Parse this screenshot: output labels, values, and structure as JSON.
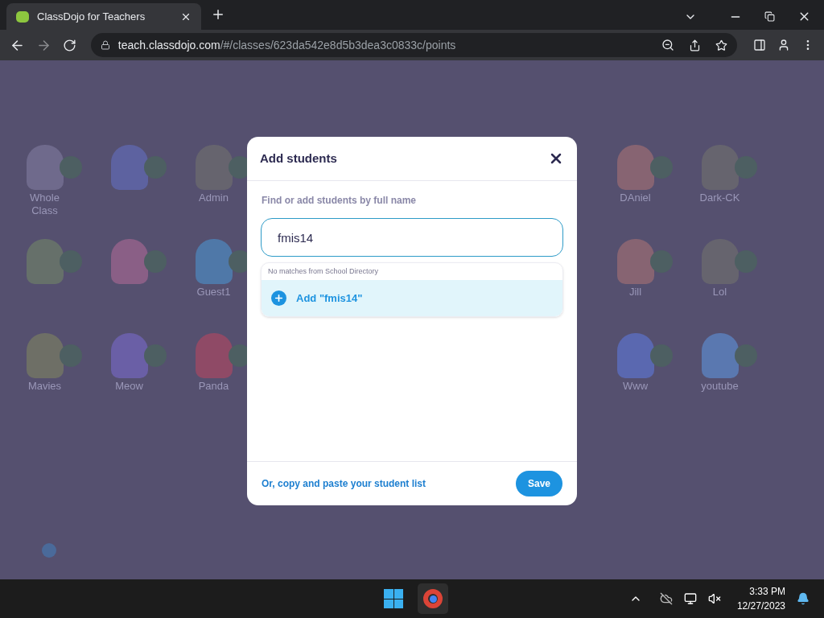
{
  "browser": {
    "tab_title": "ClassDojo for Teachers",
    "url_host": "teach.classdojo.com",
    "url_path": "/#/classes/623da542e8d5b3dea3c0833c/points"
  },
  "students_left": [
    {
      "name": "Whole\nClass",
      "color": "#6f6a8c"
    },
    {
      "color": "#5d62a0"
    },
    {
      "name": "Admin",
      "color": "#66646e"
    },
    {
      "color": "#66706a"
    },
    {
      "color": "#8a5f86"
    },
    {
      "name": "Guest1",
      "color": "#4f78a8"
    },
    {
      "name": "Mavies",
      "color": "#6e6f66"
    },
    {
      "name": "Meow",
      "color": "#6a5fa6"
    },
    {
      "name": "Panda",
      "color": "#8f4a66"
    }
  ],
  "students_right": [
    {
      "name": "DAniel",
      "color": "#876472"
    },
    {
      "name": "Dark-CK",
      "color": "#66646e"
    },
    {
      "name": "Jill",
      "color": "#876472"
    },
    {
      "name": "Lol",
      "color": "#66646e"
    },
    {
      "name": "Www",
      "color": "#5a68b0"
    },
    {
      "name": "youtube",
      "color": "#5a78b0"
    }
  ],
  "modal": {
    "title": "Add students",
    "label": "Find or add students by full name",
    "input_value": "fmis14",
    "dropdown_note": "No matches from School Directory",
    "add_option": "Add \"fmis14\"",
    "paste_link": "Or, copy and paste your student list",
    "save_button": "Save"
  },
  "taskbar": {
    "time": "3:33 PM",
    "date": "12/27/2023"
  }
}
